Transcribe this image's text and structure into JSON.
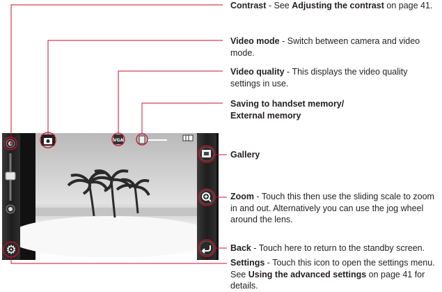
{
  "callouts": {
    "contrast": {
      "title": "Contrast",
      "sep": " - See ",
      "ref": "Adjusting the contrast",
      "tail": " on page 41."
    },
    "video_mode": {
      "title": "Video mode",
      "desc": " - Switch between camera and video mode."
    },
    "video_quality": {
      "title": "Video quality",
      "desc": " - This displays the video quality settings in use."
    },
    "memory": {
      "line1": "Saving to handset memory/",
      "line2": "External memory"
    },
    "gallery": {
      "title": "Gallery"
    },
    "zoom": {
      "title": "Zoom",
      "desc": " - Touch this then use the sliding scale to zoom in and out. Alternatively you can use the jog wheel around the lens."
    },
    "back": {
      "title": "Back",
      "desc": " - Touch here to return to the standby screen."
    },
    "settings": {
      "title": "Settings",
      "desc": " - Touch this icon to open the settings menu. See ",
      "ref": "Using the advanced settings",
      "tail": " on page 41 for details."
    }
  },
  "screen": {
    "quality_badge": "VGA",
    "icons": {
      "contrast_plus": "sun-plus-icon",
      "contrast_minus": "sun-minus-icon",
      "settings": "gear-icon",
      "camera_mode": "camera-icon",
      "memory": "sd-card-icon",
      "battery": "battery-icon",
      "gallery": "gallery-icon",
      "zoom": "zoom-in-icon",
      "back": "back-arrow-icon"
    }
  },
  "colors": {
    "leader_line": "#c8112e",
    "text": "#231f20",
    "phone_body": "#1a1a1a"
  }
}
